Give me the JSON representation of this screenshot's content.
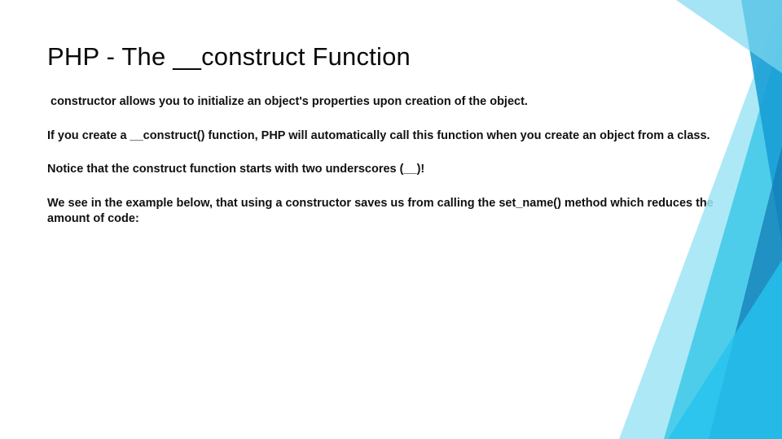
{
  "title": "PHP - The __construct Function",
  "p1": "constructor allows you to initialize an object's properties upon creation of the object.",
  "p2": "If you create a __construct() function, PHP will automatically call this function when you create an object from a class.",
  "p3": "Notice that the construct function starts with two underscores (__)!",
  "p4": "We see in the example below, that using a constructor saves us from calling the set_name() method which reduces the amount of code:"
}
